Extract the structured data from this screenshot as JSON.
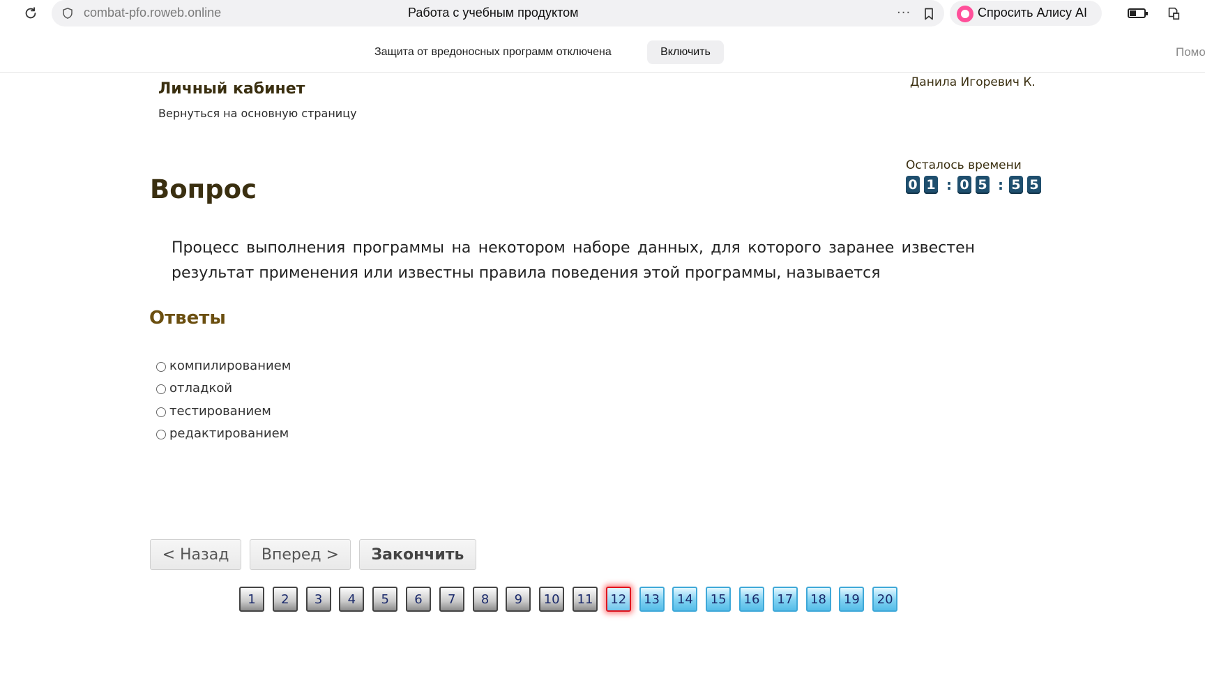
{
  "browser": {
    "url": "combat-pfo.roweb.online",
    "tab_title": "Работа с учебным продуктом",
    "menu_dots": "···",
    "alice_label": "Спросить Алису AI"
  },
  "infobar": {
    "message": "Защита от вредоносных программ отключена",
    "enable_label": "Включить",
    "help_label": "Помо"
  },
  "header": {
    "cabinet_title": "Личный кабинет",
    "back_link": "Вернуться на основную страницу",
    "user_name": "Данила Игоревич К."
  },
  "timer": {
    "label": "Осталось времени",
    "h1": "0",
    "h2": "1",
    "m1": "0",
    "m2": "5",
    "s1": "5",
    "s2": "5",
    "separator": ":"
  },
  "question": {
    "title": "Вопрос",
    "text": "Процесс выполнения программы на некотором наборе данных, для которого заранее известен результат применения или известны правила поведения этой программы, называется"
  },
  "answers": {
    "title": "Ответы",
    "options": [
      "компилированием",
      "отладкой",
      "тестированием",
      "редактированием"
    ]
  },
  "navigation": {
    "back_label": "< Назад",
    "forward_label": "Вперед >",
    "finish_label": "Закончить"
  },
  "pager": {
    "pages": [
      {
        "label": "1",
        "state": "done"
      },
      {
        "label": "2",
        "state": "done"
      },
      {
        "label": "3",
        "state": "done"
      },
      {
        "label": "4",
        "state": "done"
      },
      {
        "label": "5",
        "state": "done"
      },
      {
        "label": "6",
        "state": "done"
      },
      {
        "label": "7",
        "state": "done"
      },
      {
        "label": "8",
        "state": "done"
      },
      {
        "label": "9",
        "state": "done"
      },
      {
        "label": "10",
        "state": "done"
      },
      {
        "label": "11",
        "state": "done"
      },
      {
        "label": "12",
        "state": "current"
      },
      {
        "label": "13",
        "state": "todo"
      },
      {
        "label": "14",
        "state": "todo"
      },
      {
        "label": "15",
        "state": "todo"
      },
      {
        "label": "16",
        "state": "todo"
      },
      {
        "label": "17",
        "state": "todo"
      },
      {
        "label": "18",
        "state": "todo"
      },
      {
        "label": "19",
        "state": "todo"
      },
      {
        "label": "20",
        "state": "todo"
      }
    ]
  },
  "colors": {
    "heading": "#3a2f10",
    "answers_heading": "#6b4f10",
    "timer_digit": "#1f4f6e",
    "current_page_border": "#e0141e",
    "todo_page": "#55bde8"
  }
}
